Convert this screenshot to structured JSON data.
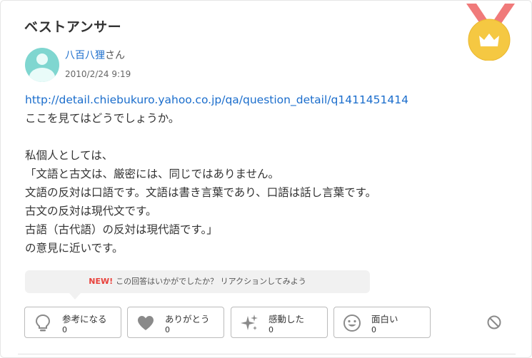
{
  "section": {
    "title": "ベストアンサー"
  },
  "author": {
    "name": "八百八狸",
    "honorific": "さん",
    "date": "2010/2/24 9:19"
  },
  "answer": {
    "lines": [
      "http://detail.chiebukuro.yahoo.co.jp/qa/question_detail/q1411451414",
      "ここを見てはどうでしょうか。",
      "",
      "私個人としては、",
      "「文語と古文は、厳密には、同じではありません。",
      "文語の反対は口語です。文語は書き言葉であり、口語は話し言葉です。",
      "古文の反対は現代文です。",
      "古語（古代語）の反対は現代語です。」",
      "の意見に近いです。"
    ]
  },
  "reaction_prompt": {
    "new_label": "NEW!",
    "text": "この回答はいかがでしたか？ リアクションしてみよう"
  },
  "reactions": [
    {
      "label": "参考になる",
      "count": "0",
      "icon": "lightbulb-icon"
    },
    {
      "label": "ありがとう",
      "count": "0",
      "icon": "heart-icon"
    },
    {
      "label": "感動した",
      "count": "0",
      "icon": "sparkle-icon"
    },
    {
      "label": "面白い",
      "count": "0",
      "icon": "smile-icon"
    }
  ],
  "icons": {
    "medal": "crown-medal-icon",
    "report": "ban-icon"
  },
  "colors": {
    "link": "#1a6dcc",
    "new_badge": "#e8413b",
    "medal_gold": "#f5c842",
    "ribbon": "#f07a7a",
    "avatar": "#7fd6d0"
  }
}
